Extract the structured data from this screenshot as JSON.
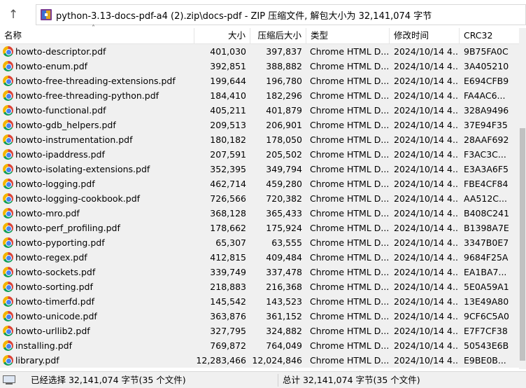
{
  "address_bar": {
    "up_icon": "up-arrow-icon",
    "path_text": "python-3.13-docs-pdf-a4 (2).zip\\docs-pdf - ZIP 压缩文件, 解包大小为 32,141,074 字节"
  },
  "columns": {
    "name": "名称",
    "size": "大小",
    "compressed": "压缩后大小",
    "type": "类型",
    "modified": "修改时间",
    "crc": "CRC32"
  },
  "rows": [
    {
      "name": "howto-descriptor.pdf",
      "size": "401,030",
      "compressed": "397,837",
      "type": "Chrome HTML D...",
      "modified": "2024/10/14 4...",
      "crc": "9B75FA0C"
    },
    {
      "name": "howto-enum.pdf",
      "size": "392,851",
      "compressed": "388,882",
      "type": "Chrome HTML D...",
      "modified": "2024/10/14 4...",
      "crc": "3A405210"
    },
    {
      "name": "howto-free-threading-extensions.pdf",
      "size": "199,644",
      "compressed": "196,780",
      "type": "Chrome HTML D...",
      "modified": "2024/10/14 4...",
      "crc": "E694CFB9"
    },
    {
      "name": "howto-free-threading-python.pdf",
      "size": "184,410",
      "compressed": "182,296",
      "type": "Chrome HTML D...",
      "modified": "2024/10/14 4...",
      "crc": "FA4AC6..."
    },
    {
      "name": "howto-functional.pdf",
      "size": "405,211",
      "compressed": "401,879",
      "type": "Chrome HTML D...",
      "modified": "2024/10/14 4...",
      "crc": "328A9496"
    },
    {
      "name": "howto-gdb_helpers.pdf",
      "size": "209,513",
      "compressed": "206,901",
      "type": "Chrome HTML D...",
      "modified": "2024/10/14 4...",
      "crc": "37E94F35"
    },
    {
      "name": "howto-instrumentation.pdf",
      "size": "180,182",
      "compressed": "178,050",
      "type": "Chrome HTML D...",
      "modified": "2024/10/14 4...",
      "crc": "28AAF692"
    },
    {
      "name": "howto-ipaddress.pdf",
      "size": "207,591",
      "compressed": "205,502",
      "type": "Chrome HTML D...",
      "modified": "2024/10/14 4...",
      "crc": "F3AC3C..."
    },
    {
      "name": "howto-isolating-extensions.pdf",
      "size": "352,395",
      "compressed": "349,794",
      "type": "Chrome HTML D...",
      "modified": "2024/10/14 4...",
      "crc": "E3A3A6F5"
    },
    {
      "name": "howto-logging.pdf",
      "size": "462,714",
      "compressed": "459,280",
      "type": "Chrome HTML D...",
      "modified": "2024/10/14 4...",
      "crc": "FBE4CF84"
    },
    {
      "name": "howto-logging-cookbook.pdf",
      "size": "726,566",
      "compressed": "720,382",
      "type": "Chrome HTML D...",
      "modified": "2024/10/14 4...",
      "crc": "AA512C..."
    },
    {
      "name": "howto-mro.pdf",
      "size": "368,128",
      "compressed": "365,433",
      "type": "Chrome HTML D...",
      "modified": "2024/10/14 4...",
      "crc": "B408C241"
    },
    {
      "name": "howto-perf_profiling.pdf",
      "size": "178,662",
      "compressed": "175,924",
      "type": "Chrome HTML D...",
      "modified": "2024/10/14 4...",
      "crc": "B1398A7E"
    },
    {
      "name": "howto-pyporting.pdf",
      "size": "65,307",
      "compressed": "63,555",
      "type": "Chrome HTML D...",
      "modified": "2024/10/14 4...",
      "crc": "3347B0E7"
    },
    {
      "name": "howto-regex.pdf",
      "size": "412,815",
      "compressed": "409,484",
      "type": "Chrome HTML D...",
      "modified": "2024/10/14 4...",
      "crc": "9684F25A"
    },
    {
      "name": "howto-sockets.pdf",
      "size": "339,749",
      "compressed": "337,478",
      "type": "Chrome HTML D...",
      "modified": "2024/10/14 4...",
      "crc": "EA1BA7..."
    },
    {
      "name": "howto-sorting.pdf",
      "size": "218,883",
      "compressed": "216,368",
      "type": "Chrome HTML D...",
      "modified": "2024/10/14 4...",
      "crc": "5E0A59A1"
    },
    {
      "name": "howto-timerfd.pdf",
      "size": "145,542",
      "compressed": "143,523",
      "type": "Chrome HTML D...",
      "modified": "2024/10/14 4...",
      "crc": "13E49A80"
    },
    {
      "name": "howto-unicode.pdf",
      "size": "363,876",
      "compressed": "361,152",
      "type": "Chrome HTML D...",
      "modified": "2024/10/14 4...",
      "crc": "9CF6C5A0"
    },
    {
      "name": "howto-urllib2.pdf",
      "size": "327,795",
      "compressed": "324,882",
      "type": "Chrome HTML D...",
      "modified": "2024/10/14 4...",
      "crc": "E7F7CF38"
    },
    {
      "name": "installing.pdf",
      "size": "769,872",
      "compressed": "764,049",
      "type": "Chrome HTML D...",
      "modified": "2024/10/14 4...",
      "crc": "50543E6B"
    },
    {
      "name": "library.pdf",
      "size": "12,283,466",
      "compressed": "12,024,846",
      "type": "Chrome HTML D...",
      "modified": "2024/10/14 4...",
      "crc": "E9BE0B..."
    }
  ],
  "status": {
    "selected": "已经选择 32,141,074 字节(35 个文件)",
    "total": "总计 32,141,074 字节(35 个文件)"
  },
  "colors": {
    "selection_bg": "#f0f0f0",
    "status_bg": "#f0f0f0"
  }
}
